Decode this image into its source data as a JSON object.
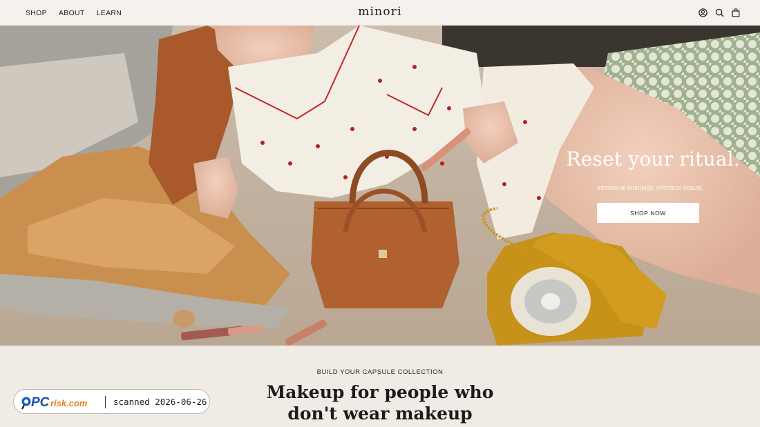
{
  "header": {
    "nav": [
      "SHOP",
      "ABOUT",
      "LEARN"
    ],
    "logo": "minori",
    "icons": [
      "account-icon",
      "search-icon",
      "cart-icon"
    ]
  },
  "hero": {
    "title": "Reset your ritual.",
    "subtitle": "Intentional mornings, effortless beauty.",
    "cta": "SHOP NOW"
  },
  "capsule": {
    "eyebrow": "BUILD YOUR CAPSULE COLLECTION",
    "headline": "Makeup for people who don't wear makeup"
  },
  "watermark": {
    "brand": "PCrisk.com",
    "text": "scanned 2026-06-26"
  },
  "colors": {
    "header_bg": "#f5f1ec",
    "section_bg": "#f1ebe5",
    "button_bg": "#ffffff",
    "text": "#1c1c1c"
  }
}
